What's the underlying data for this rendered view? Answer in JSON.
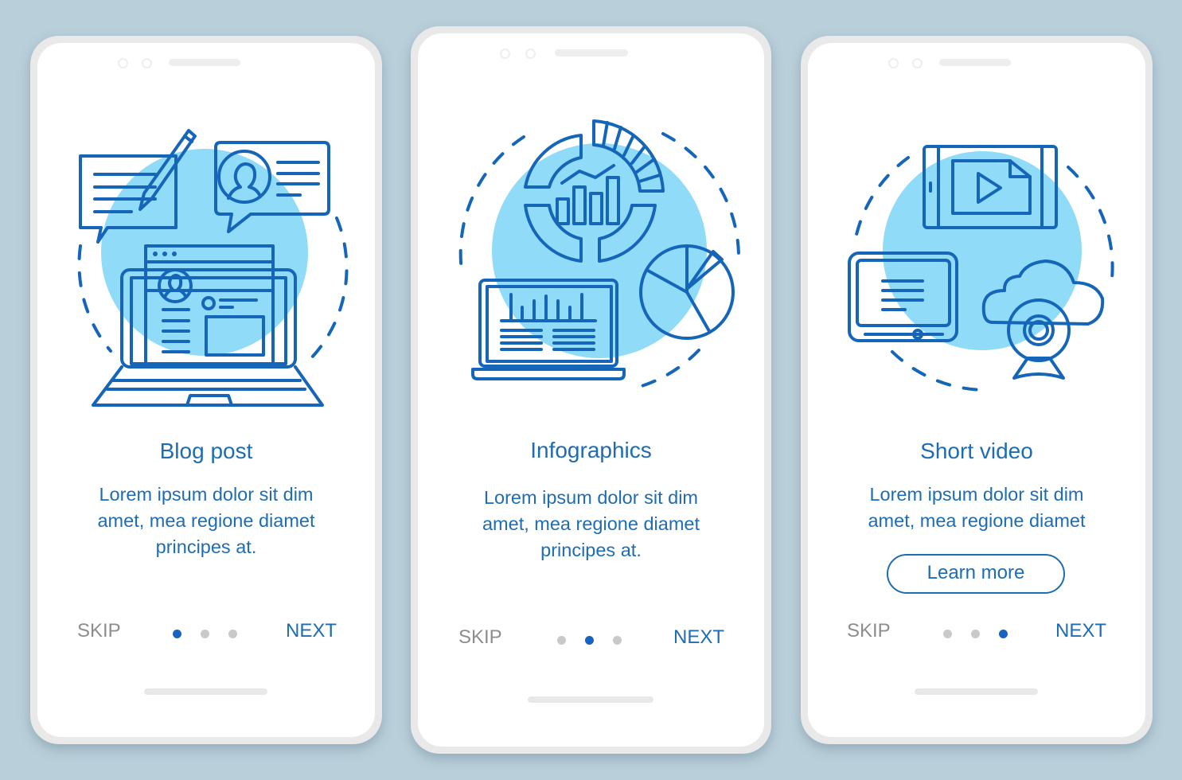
{
  "colors": {
    "background": "#b9cfda",
    "accent": "#1e6cb2",
    "icon_stroke": "#1565b8",
    "bubble_fill": "#8fdbf8",
    "mid_fill": "#5eb8f2",
    "pale_fill": "#c4f3fb",
    "muted_text": "#8d8d8d",
    "dot_inactive": "#c9c9c9",
    "dot_active": "#1565c0"
  },
  "screens": [
    {
      "illustration": "blog-post-illustration",
      "title": "Blog post",
      "body_lines": [
        "Lorem ipsum dolor sit dim",
        "amet, mea regione diamet",
        "principes at."
      ],
      "skip_label": "SKIP",
      "next_label": "NEXT",
      "page_index": 1,
      "page_count": 3
    },
    {
      "illustration": "infographics-illustration",
      "title": "Infographics",
      "body_lines": [
        "Lorem ipsum dolor sit dim",
        "amet, mea regione diamet",
        "principes at."
      ],
      "skip_label": "SKIP",
      "next_label": "NEXT",
      "page_index": 2,
      "page_count": 3
    },
    {
      "illustration": "short-video-illustration",
      "title": "Short video",
      "body_lines": [
        "Lorem ipsum dolor sit dim",
        "amet, mea regione diamet"
      ],
      "button_label": "Learn more",
      "skip_label": "SKIP",
      "next_label": "NEXT",
      "page_index": 3,
      "page_count": 3
    }
  ]
}
